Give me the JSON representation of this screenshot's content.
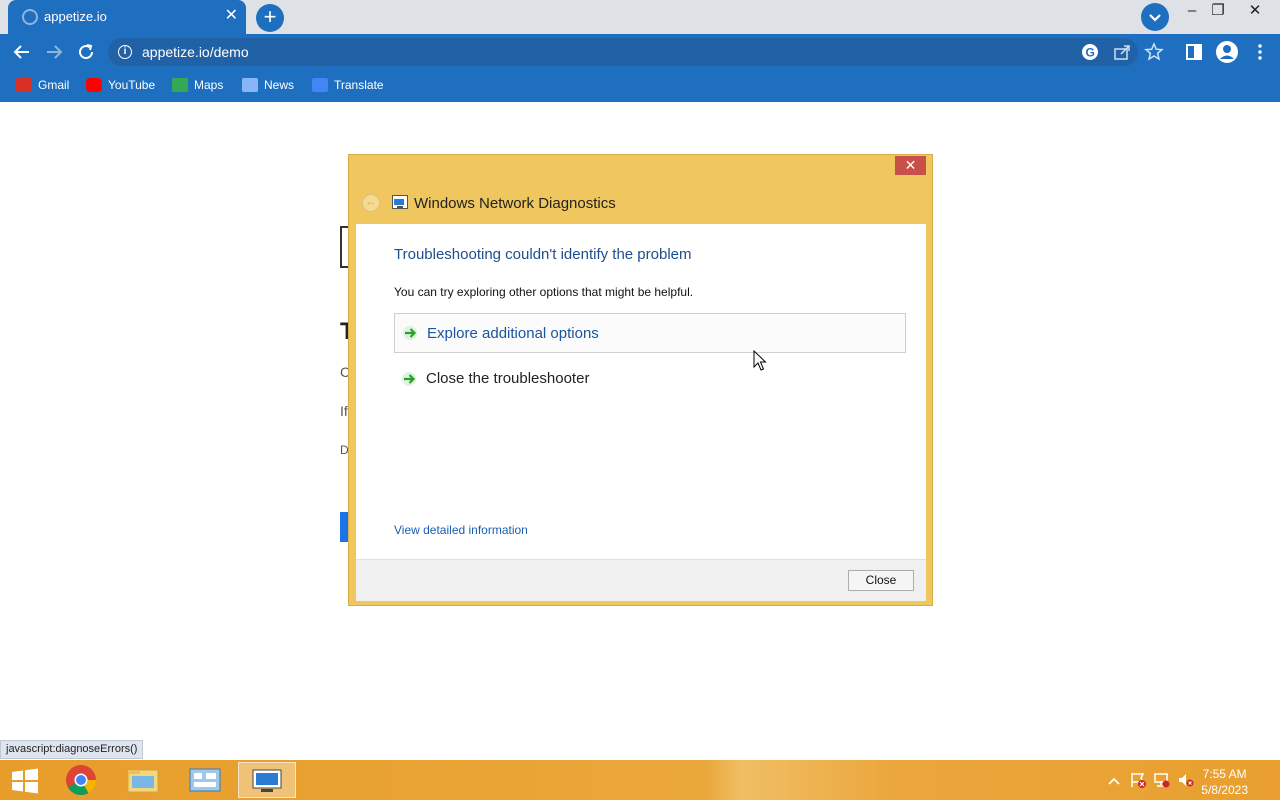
{
  "browser": {
    "tab_title": "appetize.io",
    "tab_close": "✕",
    "new_tab": "+",
    "url": "appetize.io/demo",
    "window_controls": {
      "minimize": "–",
      "restore": "❐",
      "close": "✕"
    },
    "bookmarks": [
      {
        "label": "Gmail",
        "color": "#d93025"
      },
      {
        "label": "YouTube",
        "color": "#ff0000"
      },
      {
        "label": "Maps",
        "color": "#34a853"
      },
      {
        "label": "News",
        "color": "#8ab4f8"
      },
      {
        "label": "Translate",
        "color": "#4285f4"
      }
    ]
  },
  "page_behind": {
    "fragments": [
      "T",
      "C",
      "If",
      "D"
    ]
  },
  "dialog": {
    "close_glyph": "✕",
    "back_glyph": "←",
    "title": "Windows Network Diagnostics",
    "heading": "Troubleshooting couldn't identify the problem",
    "subtext": "You can try exploring other options that might be helpful.",
    "options": [
      {
        "label": "Explore additional options"
      },
      {
        "label": "Close the troubleshooter"
      }
    ],
    "detail_link": "View detailed information",
    "close_button": "Close"
  },
  "status_bar": "javascript:diagnoseErrors()",
  "taskbar": {
    "time": "7:55 AM",
    "date": "5/8/2023"
  },
  "colors": {
    "chrome_blue": "#1f6fc1",
    "dialog_frame": "#f0c75e",
    "taskbar_orange": "#e89f2f"
  }
}
